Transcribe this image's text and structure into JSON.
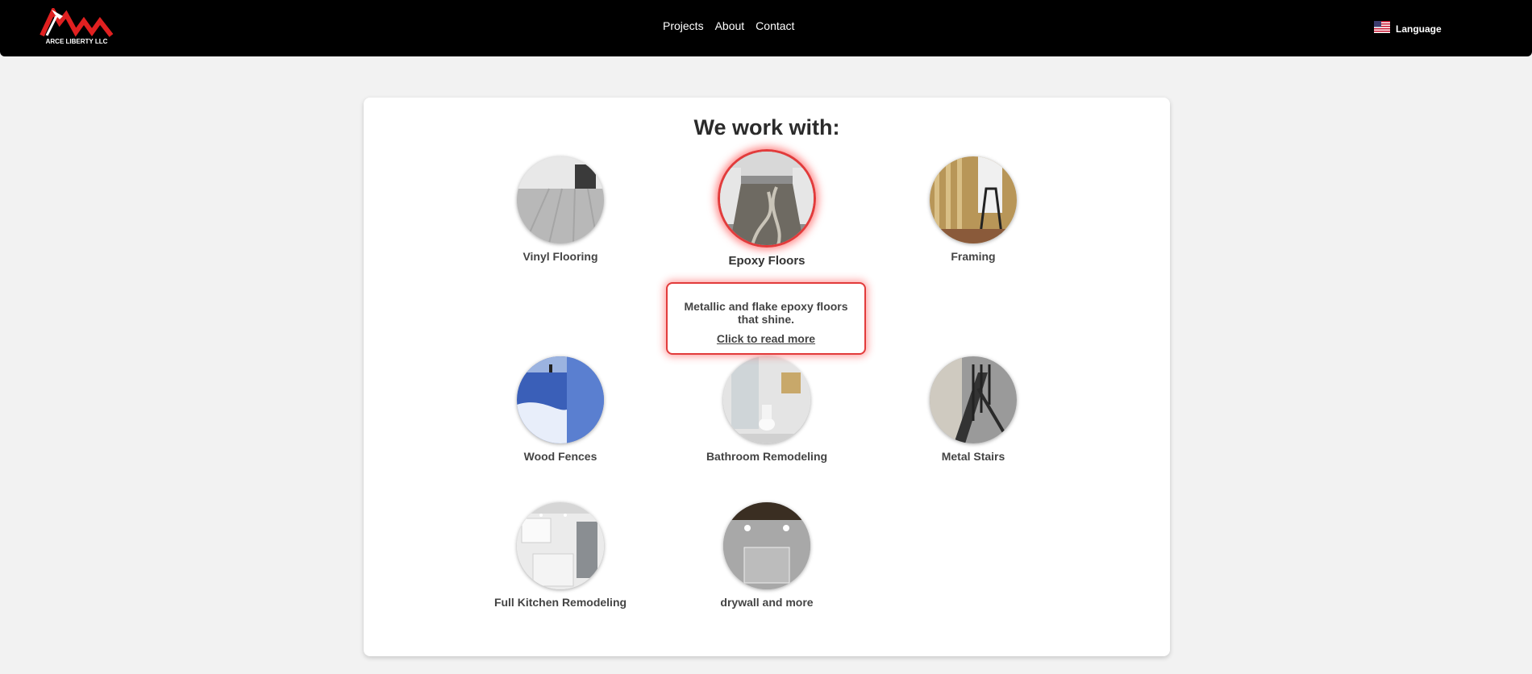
{
  "header": {
    "logo_text": "ARCE LIBERTY LLC",
    "nav": [
      {
        "label": "Projects"
      },
      {
        "label": "About"
      },
      {
        "label": "Contact"
      }
    ],
    "language": {
      "label": "Language",
      "icon": "us-flag-icon"
    }
  },
  "main": {
    "title": "We work with:",
    "services": [
      {
        "label": "Vinyl Flooring",
        "active": false
      },
      {
        "label": "Epoxy Floors",
        "active": true
      },
      {
        "label": "Framing",
        "active": false
      },
      {
        "label": "Wood Fences",
        "active": false
      },
      {
        "label": "Bathroom Remodeling",
        "active": false
      },
      {
        "label": "Metal Stairs",
        "active": false
      },
      {
        "label": "Full Kitchen Remodeling",
        "active": false
      },
      {
        "label": "drywall and more",
        "active": false
      }
    ],
    "tooltip": {
      "description": "Metallic and flake epoxy floors that shine.",
      "link": "Click to read more"
    }
  },
  "colors": {
    "header_bg": "#000000",
    "page_bg": "#f2f2f2",
    "accent_red": "#e23b3b"
  }
}
